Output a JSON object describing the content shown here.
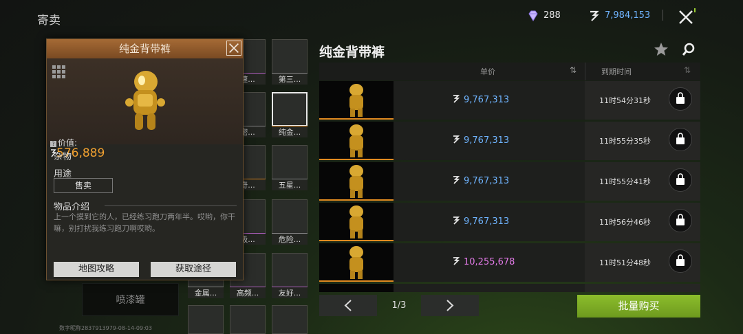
{
  "header": {
    "title": "寄卖",
    "gems": "288",
    "coins": "7,984,153"
  },
  "background": {
    "spray_label": "喷漆罐",
    "footer_id": "数字昵称2837913979-08-14-09:03"
  },
  "grid": {
    "items": [
      {
        "name": "速...",
        "bar": "#b060c0"
      },
      {
        "name": "第三...",
        "bar": "#888888"
      },
      {
        "name": "密...",
        "bar": "#888888"
      },
      {
        "name": "纯金...",
        "bar": "#e08a20"
      },
      {
        "name": "奇...",
        "bar": "#e08a20"
      },
      {
        "name": "五星...",
        "bar": "#888888"
      },
      {
        "name": "级...",
        "bar": "#b060c0"
      },
      {
        "name": "危险...",
        "bar": "#888888"
      },
      {
        "name": "金属...",
        "bar": "#888888"
      },
      {
        "name": "高频...",
        "bar": "#b060c0"
      },
      {
        "name": "友好...",
        "bar": "#b060c0"
      }
    ]
  },
  "popup": {
    "title": "纯金背带裤",
    "value_label": "价值:",
    "value": "576,889",
    "category": "杂物",
    "use_title": "用途",
    "use_button": "售卖",
    "desc_title": "物品介绍",
    "desc": "上一个摸到它的人，已经练习跑刀两年半。哎哟，你干嘛，别打扰我练习跑刀啊哎哟。",
    "btn_map": "地图攻略",
    "btn_source": "获取途径"
  },
  "market": {
    "title": "纯金背带裤",
    "col_price": "单价",
    "col_time": "到期时间",
    "rows": [
      {
        "price": "9,767,313",
        "time": "11时54分31秒",
        "price_color": "#6fb4ff"
      },
      {
        "price": "9,767,313",
        "time": "11时55分35秒",
        "price_color": "#6fb4ff"
      },
      {
        "price": "9,767,313",
        "time": "11时55分41秒",
        "price_color": "#6fb4ff"
      },
      {
        "price": "9,767,313",
        "time": "11时56分46秒",
        "price_color": "#6fb4ff"
      },
      {
        "price": "10,255,678",
        "time": "11时51分48秒",
        "price_color": "#e37ae8"
      }
    ],
    "pager": "1/3",
    "bulk_buy": "批量购买"
  },
  "colors": {
    "accent_green": "#8cbd2c",
    "price_blue": "#6fb4ff",
    "price_pink": "#e37ae8",
    "value_orange": "#f0a030"
  }
}
